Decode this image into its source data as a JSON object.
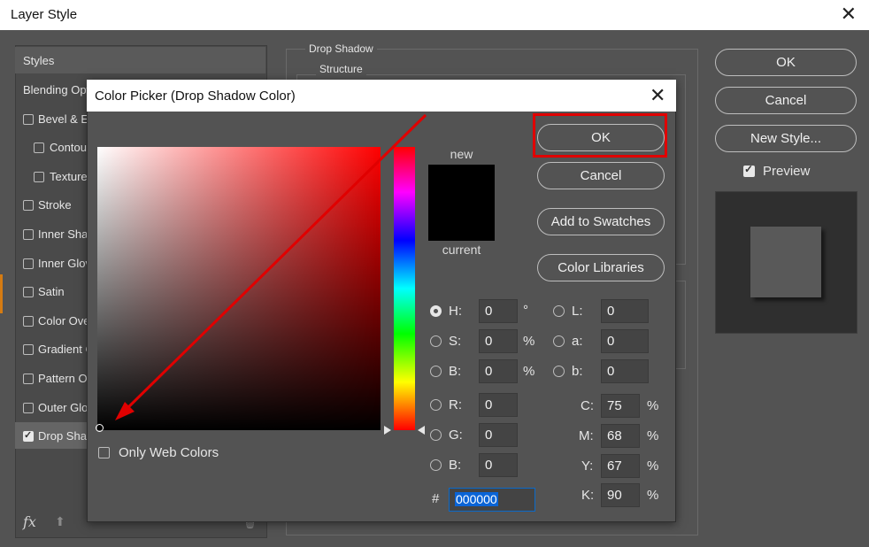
{
  "layer_style": {
    "title": "Layer Style",
    "close_glyph": "✕",
    "styles_header": "Styles",
    "items": [
      {
        "label": "Blending Opti",
        "checkbox": false,
        "checked": false,
        "indent": false
      },
      {
        "label": "Bevel & E",
        "checkbox": true,
        "checked": false,
        "indent": false
      },
      {
        "label": "Contour",
        "checkbox": true,
        "checked": false,
        "indent": true
      },
      {
        "label": "Texture",
        "checkbox": true,
        "checked": false,
        "indent": true
      },
      {
        "label": "Stroke",
        "checkbox": true,
        "checked": false,
        "indent": false
      },
      {
        "label": "Inner Sha",
        "checkbox": true,
        "checked": false,
        "indent": false
      },
      {
        "label": "Inner Glov",
        "checkbox": true,
        "checked": false,
        "indent": false
      },
      {
        "label": "Satin",
        "checkbox": true,
        "checked": false,
        "indent": false
      },
      {
        "label": "Color Ove",
        "checkbox": true,
        "checked": false,
        "indent": false
      },
      {
        "label": "Gradient C",
        "checkbox": true,
        "checked": false,
        "indent": false
      },
      {
        "label": "Pattern Ov",
        "checkbox": true,
        "checked": false,
        "indent": false
      },
      {
        "label": "Outer Glov",
        "checkbox": true,
        "checked": false,
        "indent": false
      },
      {
        "label": "Drop Shac",
        "checkbox": true,
        "checked": true,
        "indent": false
      }
    ],
    "fx_label": "fx",
    "drop_shadow_label": "Drop Shadow",
    "structure_label": "Structure",
    "ok_label": "OK",
    "cancel_label": "Cancel",
    "new_style_label": "New Style...",
    "preview_label": "Preview",
    "preview_checked": true
  },
  "color_picker": {
    "title": "Color Picker (Drop Shadow Color)",
    "close_glyph": "✕",
    "new_label": "new",
    "current_label": "current",
    "new_color": "#000000",
    "current_color": "#000000",
    "ok_label": "OK",
    "cancel_label": "Cancel",
    "add_swatches_label": "Add to Swatches",
    "color_libraries_label": "Color Libraries",
    "only_web_colors_label": "Only Web Colors",
    "only_web_colors_checked": false,
    "hsb": {
      "h": {
        "label": "H:",
        "value": "0",
        "unit": "°",
        "selected": true
      },
      "s": {
        "label": "S:",
        "value": "0",
        "unit": "%",
        "selected": false
      },
      "b": {
        "label": "B:",
        "value": "0",
        "unit": "%",
        "selected": false
      }
    },
    "rgb": {
      "r": {
        "label": "R:",
        "value": "0"
      },
      "g": {
        "label": "G:",
        "value": "0"
      },
      "b": {
        "label": "B:",
        "value": "0"
      }
    },
    "lab": {
      "l": {
        "label": "L:",
        "value": "0"
      },
      "a": {
        "label": "a:",
        "value": "0"
      },
      "b": {
        "label": "b:",
        "value": "0"
      }
    },
    "cmyk": {
      "c": {
        "label": "C:",
        "value": "75",
        "unit": "%"
      },
      "m": {
        "label": "M:",
        "value": "68",
        "unit": "%"
      },
      "y": {
        "label": "Y:",
        "value": "67",
        "unit": "%"
      },
      "k": {
        "label": "K:",
        "value": "90",
        "unit": "%"
      }
    },
    "hex_hash": "#",
    "hex_value": "000000"
  },
  "colors": {
    "annotation_red": "#e00000",
    "accent_blue": "#0a64d6"
  }
}
